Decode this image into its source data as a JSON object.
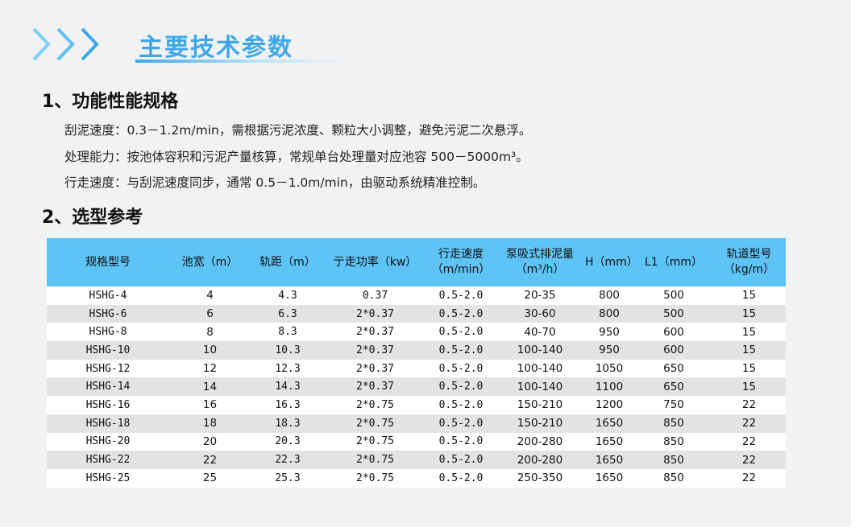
{
  "page": {
    "title": "主要技术参数"
  },
  "section1": {
    "heading": "1、功能性能规格",
    "lines": [
      "刮泥速度：0.3－1.2m/min，需根据污泥浓度、颗粒大小调整，避免污泥二次悬浮。",
      "处理能力：按池体容积和污泥产量核算，常规单台处理量对应池容 500－5000m³。",
      "行走速度：与刮泥速度同步，通常 0.5－1.0m/min，由驱动系统精准控制。"
    ]
  },
  "section2": {
    "heading": "2、选型参考"
  },
  "table": {
    "headers": [
      [
        "规格型号",
        ""
      ],
      [
        "池宽（m）",
        ""
      ],
      [
        "轨距（m）",
        ""
      ],
      [
        "亍走功率（kw）",
        ""
      ],
      [
        "行走速度",
        "（m/min）"
      ],
      [
        "泵吸式排泥量",
        "（m³/h）"
      ],
      [
        "H（mm）",
        ""
      ],
      [
        "L1（mm）",
        ""
      ],
      [
        "轨道型号",
        "（kg/m）"
      ]
    ],
    "rows": [
      [
        "HSHG-4",
        "4",
        "4.3",
        "0.37",
        "0.5-2.0",
        "20-35",
        "800",
        "500",
        "15"
      ],
      [
        "HSHG-6",
        "6",
        "6.3",
        "2*0.37",
        "0.5-2.0",
        "30-60",
        "800",
        "500",
        "15"
      ],
      [
        "HSHG-8",
        "8",
        "8.3",
        "2*0.37",
        "0.5-2.0",
        "40-70",
        "950",
        "600",
        "15"
      ],
      [
        "HSHG-10",
        "10",
        "10.3",
        "2*0.37",
        "0.5-2.0",
        "100-140",
        "950",
        "600",
        "15"
      ],
      [
        "HSHG-12",
        "12",
        "12.3",
        "2*0.37",
        "0.5-2.0",
        "100-140",
        "1050",
        "650",
        "15"
      ],
      [
        "HSHG-14",
        "14",
        "14.3",
        "2*0.37",
        "0.5-2.0",
        "100-140",
        "1100",
        "650",
        "15"
      ],
      [
        "HSHG-16",
        "16",
        "16.3",
        "2*0.75",
        "0.5-2.0",
        "150-210",
        "1200",
        "750",
        "22"
      ],
      [
        "HSHG-18",
        "18",
        "18.3",
        "2*0.75",
        "0.5-2.0",
        "150-210",
        "1650",
        "850",
        "22"
      ],
      [
        "HSHG-20",
        "20",
        "20.3",
        "2*0.75",
        "0.5-2.0",
        "200-280",
        "1650",
        "850",
        "22"
      ],
      [
        "HSHG-22",
        "22",
        "22.3",
        "2*0.75",
        "0.5-2.0",
        "200-280",
        "1650",
        "850",
        "22"
      ],
      [
        "HSHG-25",
        "25",
        "25.3",
        "2*0.75",
        "0.5-2.0",
        "250-350",
        "1650",
        "850",
        "22"
      ]
    ]
  },
  "colors": {
    "accent": "#3fa7e8",
    "header_bg": "#5ec4f6",
    "row_alt": "#e3e3e3",
    "page_bg": "#f1f2f4"
  },
  "icons": {
    "title_decoration": "triple-chevron-right-icon"
  }
}
